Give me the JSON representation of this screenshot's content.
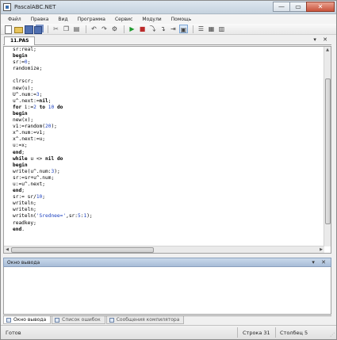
{
  "window": {
    "title": "PascalABC.NET",
    "minimize": "—",
    "maximize": "▭",
    "close": "✕"
  },
  "menu": [
    "Файл",
    "Правка",
    "Вид",
    "Программа",
    "Сервис",
    "Модули",
    "Помощь"
  ],
  "toolbar": {
    "icons": [
      "new-icon",
      "open-icon",
      "save-icon",
      "save-all-icon",
      "cut-icon",
      "copy-icon",
      "paste-icon",
      "undo-icon",
      "redo-icon",
      "compile-icon",
      "run-icon",
      "stop-icon",
      "step-into-icon",
      "step-over-icon",
      "run-to-cursor-icon",
      "output-window-icon",
      "format-icon",
      "settings-icon",
      "help-icon"
    ]
  },
  "tab": {
    "label": "11.PAS",
    "controls": "▾ ✕"
  },
  "editor": {
    "lines": [
      "sr:real;",
      "begin",
      "sr:=0;",
      "randomize;",
      "",
      "clrscr;",
      "new(u);",
      "U^.num:=3;",
      "u^.next:=nil;",
      "for i:=2 to 10 do",
      "begin",
      "new(x);",
      "v1:=random(20);",
      "x^.num:=v1;",
      "x^.next:=u;",
      "u:=x;",
      "end;",
      "while u <> nil do",
      "begin",
      "write(u^.num:3);",
      "sr:=sr+u^.num;",
      "u:=u^.next;",
      "end;",
      "sr:= sr/10;",
      "writeln;",
      "writeln;",
      "writeln('Srednee=',sr:5:1);",
      "readkey;",
      "end."
    ]
  },
  "output": {
    "title": "Окно вывода",
    "controls": "▾ ✕"
  },
  "bottom_tabs": [
    "Окно вывода",
    "Список ошибок",
    "Сообщения компилятора"
  ],
  "status": {
    "ready": "Готов",
    "row": "Строка 31",
    "col": "Столбец 5"
  }
}
